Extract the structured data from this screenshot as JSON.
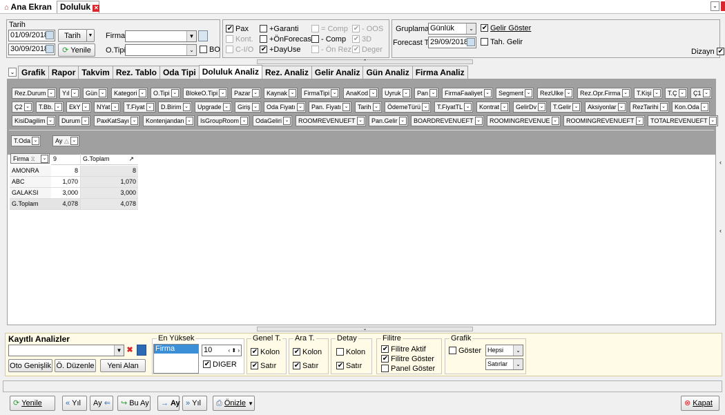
{
  "window_tabs": [
    {
      "label": "Ana Ekran",
      "icon": "home-icon"
    },
    {
      "label": "Doluluk",
      "icon": "close-icon"
    }
  ],
  "filter": {
    "tarih_label": "Tarih",
    "date_start": "01/09/2018",
    "date_end": "30/09/2018",
    "tarih_button": "Tarih",
    "yenile_button": "Yenile",
    "firma_label": "Firma",
    "firma_value": "",
    "otipi_label": "O.Tipi",
    "otipi_value": "",
    "bo_label": "BO"
  },
  "options": {
    "col1": [
      {
        "label": "Pax",
        "checked": true,
        "disabled": false
      },
      {
        "label": "Kont.",
        "checked": false,
        "disabled": true
      },
      {
        "label": "C-I/O",
        "checked": false,
        "disabled": true
      }
    ],
    "col2": [
      {
        "label": "+Garanti",
        "checked": false,
        "disabled": false
      },
      {
        "label": "+ÖnForecast",
        "checked": false,
        "disabled": false
      },
      {
        "label": "+DayUse",
        "checked": true,
        "disabled": false
      }
    ],
    "col3": [
      {
        "label": "= Comp",
        "checked": false,
        "disabled": true
      },
      {
        "label": "- Comp",
        "checked": false,
        "disabled": false
      },
      {
        "label": "- Ön Rez.",
        "checked": false,
        "disabled": true
      }
    ],
    "col4": [
      {
        "label": "- OOS",
        "checked": true,
        "disabled": true
      },
      {
        "label": "3D",
        "checked": true,
        "disabled": true
      },
      {
        "label": "Deger",
        "checked": true,
        "disabled": true
      }
    ]
  },
  "grouping": {
    "gruplama_label": "Gruplama",
    "gruplama_value": "Günlük",
    "gelir_goster": "Gelir Göster",
    "forecast_label": "Forecast T.",
    "forecast_value": "29/09/2018",
    "tah_gelir": "Tah. Gelir",
    "dizayn": "Dizayn"
  },
  "tabs": [
    "Grafik",
    "Rapor",
    "Takvim",
    "Rez. Tablo",
    "Oda Tipi",
    "Doluluk Analiz",
    "Rez. Analiz",
    "Gelir Analiz",
    "Gün Analiz",
    "Firma Analiz"
  ],
  "active_tab": "Doluluk Analiz",
  "field_rows": [
    [
      "Rez.Durum",
      "Yıl",
      "Gün",
      "Kategori",
      "O.Tipi",
      "BlokeO.Tipi",
      "Pazar",
      "Kaynak",
      "FirmaTipi",
      "AnaKod",
      "Uyruk",
      "Pan",
      "FirmaFaaliyet",
      "Segment",
      "RezUlke",
      "Rez.Opr.Firma",
      "T.Kişi",
      "T.Ç",
      "Ç1"
    ],
    [
      "Ç2",
      "T.Bb.",
      "EkY",
      "NYat",
      "T.Fiyat",
      "D.Birim",
      "Upgrade",
      "Giriş",
      "Oda Fiyatı",
      "Pan. Fiyatı",
      "Tarih",
      "ÖdemeTürü",
      "T.FiyatTL",
      "Kontrat",
      "GelirDv",
      "T.Gelir",
      "Aksiyonlar",
      "RezTarihi",
      "Kon.Oda"
    ],
    [
      "KisiDagilim",
      "Durum",
      "PaxKatSayı",
      "Kontenjandan",
      "IsGroupRoom",
      "OdaGeliri",
      "ROOMREVENUEFT",
      "Pan.Gelir",
      "BOARDREVENUEFT",
      "ROOMINGREVENUE",
      "ROOMINGREVENUEFT",
      "TOTALREVENUEFT"
    ]
  ],
  "data_field": "T.Oda",
  "column_field": "Ay",
  "row_field": "Firma",
  "grid": {
    "headers": [
      "9",
      "G.Toplam"
    ],
    "rows": [
      {
        "name": "AMONRA",
        "v1": "8",
        "v2": "8"
      },
      {
        "name": "ABC",
        "v1": "1,070",
        "v2": "1,070"
      },
      {
        "name": "GALAKSI",
        "v1": "3,000",
        "v2": "3,000"
      },
      {
        "name": "G.Toplam",
        "v1": "4,078",
        "v2": "4,078"
      }
    ]
  },
  "bottom_panel": {
    "kayitli_title": "Kayıtlı Analizler",
    "oto_genislik": "Oto Genişlik",
    "o_duzenle": "Ö. Düzenle",
    "yeni_alan": "Yeni Alan",
    "en_yuksek": "En Yüksek",
    "list_item": "Firma",
    "spin_value": "10",
    "diger": "DIGER",
    "genel_t": "Genel T.",
    "ara_t": "Ara T.",
    "detay": "Detay",
    "kolon": "Kolon",
    "satir": "Satır",
    "filitre": "Filitre",
    "filitre_aktif": "Filitre Aktif",
    "filitre_goster": "Filitre Göster",
    "panel_goster": "Panel Göster",
    "grafik": "Grafik",
    "goster": "Göster",
    "hepsi": "Hepsi",
    "satirlar": "Satırlar"
  },
  "footer": {
    "yenile": "Yenile",
    "yil_back": "Yıl",
    "ay_back": "Ay",
    "bu_ay": "Bu Ay",
    "ay_fwd": "Ay",
    "yil_fwd": "Yıl",
    "onizle": "Önizle",
    "kapat": "Kapat"
  },
  "colors": {
    "accent": "#2d6ab4",
    "close": "#d9262c",
    "panel_bg": "#fffbe6",
    "grid_gray": "#a0a0a0"
  }
}
